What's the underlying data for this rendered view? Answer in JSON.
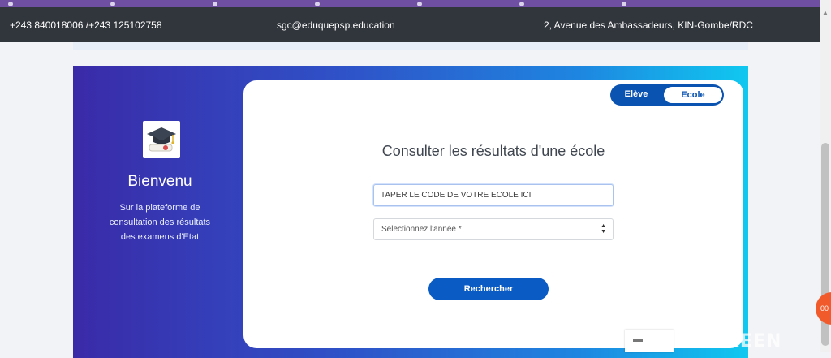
{
  "topbar": {
    "phone": "+243 840018006 /+243 125102758",
    "email": "sgc@eduquepsp.education",
    "address": "2, Avenue des Ambassadeurs, KIN-Gombe/RDC"
  },
  "hero": {
    "logo_icon": "graduation-cap-diploma-icon",
    "welcome": "Bienvenu",
    "subtitle": "Sur la plateforme de consultation des résultats des examens d'Etat"
  },
  "form": {
    "toggle": {
      "eleve": "Elève",
      "ecole": "Ecole",
      "selected": "Ecole"
    },
    "title": "Consulter les résultats d'une école",
    "code_placeholder": "TAPER LE CODE DE VOTRE ECOLE ICI",
    "year_select": "Selectionnez l'année *",
    "search_button": "Rechercher"
  },
  "overlay": {
    "watermark": "SCREEN",
    "badge": "00"
  },
  "colors": {
    "topbar": "#31363c",
    "gradient_start": "#3a2aa8",
    "gradient_end": "#10c8f0",
    "primary_button": "#0a5bc4",
    "toggle": "#0b53b0"
  }
}
